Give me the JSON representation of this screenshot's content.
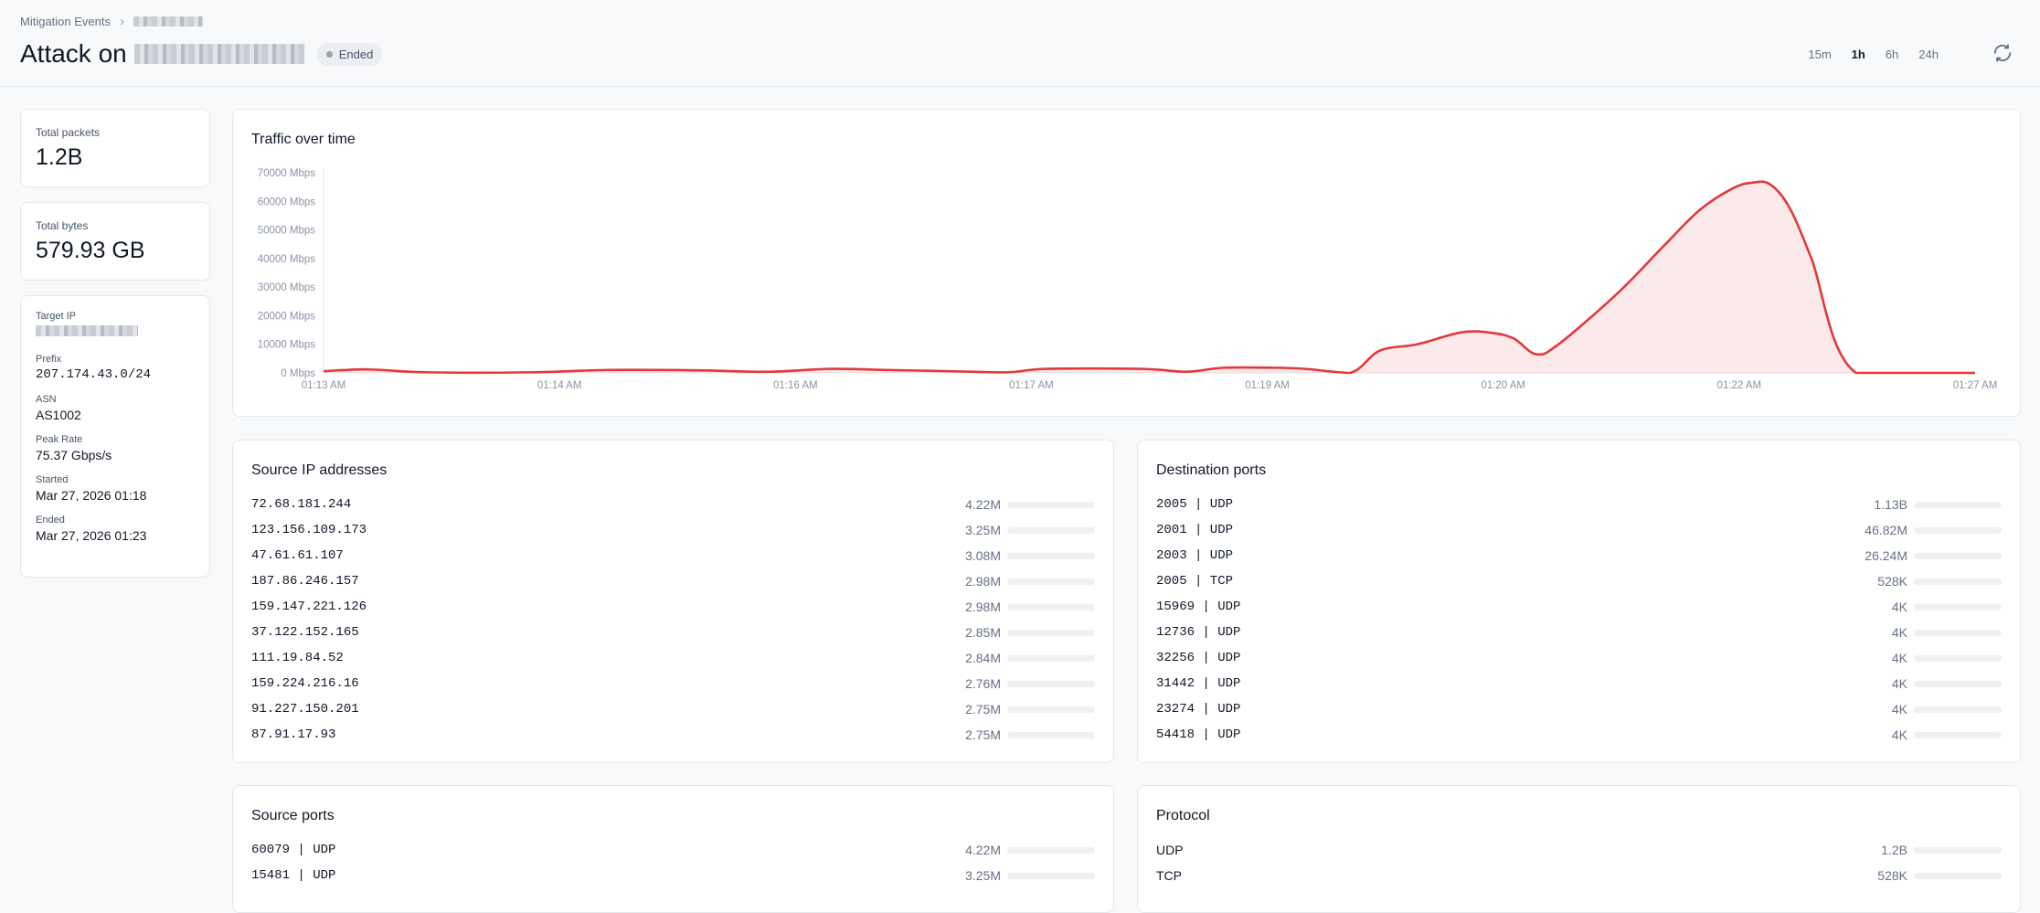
{
  "breadcrumb": {
    "root": "Mitigation Events"
  },
  "header": {
    "title": "Attack on",
    "status": "Ended"
  },
  "time_ranges": [
    {
      "label": "15m",
      "active": false
    },
    {
      "label": "1h",
      "active": true
    },
    {
      "label": "6h",
      "active": false
    },
    {
      "label": "24h",
      "active": false
    }
  ],
  "stats": {
    "total_packets": {
      "label": "Total packets",
      "value": "1.2B"
    },
    "total_bytes": {
      "label": "Total bytes",
      "value": "579.93 GB"
    }
  },
  "info": {
    "target_ip_label": "Target IP",
    "prefix_label": "Prefix",
    "prefix": "207.174.43.0/24",
    "asn_label": "ASN",
    "asn": "AS1002",
    "peak_label": "Peak Rate",
    "peak": "75.37 Gbps/s",
    "started_label": "Started",
    "started": "Mar 27, 2026 01:18",
    "ended_label": "Ended",
    "ended": "Mar 27, 2026 01:23"
  },
  "traffic": {
    "title": "Traffic over time"
  },
  "chart_data": {
    "type": "area",
    "title": "Traffic over time",
    "y_ticks": [
      "0 Mbps",
      "10000 Mbps",
      "20000 Mbps",
      "30000 Mbps",
      "40000 Mbps",
      "50000 Mbps",
      "60000 Mbps",
      "70000 Mbps"
    ],
    "ylim": [
      0,
      70000
    ],
    "x_ticks": [
      "01:13 AM",
      "01:14 AM",
      "01:16 AM",
      "01:17 AM",
      "01:19 AM",
      "01:20 AM",
      "01:22 AM",
      "01:27 AM"
    ],
    "series": [
      {
        "color": "#e5383b",
        "points": [
          [
            0,
            600
          ],
          [
            3,
            1200
          ],
          [
            7,
            200
          ],
          [
            14,
            200
          ],
          [
            19,
            1000
          ],
          [
            25,
            900
          ],
          [
            30,
            400
          ],
          [
            34,
            1400
          ],
          [
            38,
            1000
          ],
          [
            42,
            600
          ],
          [
            46,
            200
          ],
          [
            48.5,
            1400
          ],
          [
            55,
            1400
          ],
          [
            58,
            400
          ],
          [
            60.5,
            1800
          ],
          [
            64,
            1800
          ],
          [
            66,
            1400
          ],
          [
            69,
            0
          ],
          [
            71,
            7800
          ],
          [
            73.5,
            10000
          ],
          [
            76.5,
            14200
          ],
          [
            78.5,
            14000
          ],
          [
            80,
            12000
          ],
          [
            81.5,
            6500
          ],
          [
            83,
            10000
          ],
          [
            87,
            28000
          ],
          [
            90,
            44000
          ],
          [
            92.5,
            57000
          ],
          [
            94.7,
            64500
          ],
          [
            96,
            66500
          ],
          [
            97.2,
            66000
          ],
          [
            98.5,
            58000
          ],
          [
            100,
            40000
          ],
          [
            103,
            0
          ],
          [
            111,
            0
          ]
        ]
      }
    ]
  },
  "source_ips": {
    "title": "Source IP addresses",
    "rows": [
      {
        "label": "72.68.181.244",
        "value": "4.22M"
      },
      {
        "label": "123.156.109.173",
        "value": "3.25M"
      },
      {
        "label": "47.61.61.107",
        "value": "3.08M"
      },
      {
        "label": "187.86.246.157",
        "value": "2.98M"
      },
      {
        "label": "159.147.221.126",
        "value": "2.98M"
      },
      {
        "label": "37.122.152.165",
        "value": "2.85M"
      },
      {
        "label": "111.19.84.52",
        "value": "2.84M"
      },
      {
        "label": "159.224.216.16",
        "value": "2.76M"
      },
      {
        "label": "91.227.150.201",
        "value": "2.75M"
      },
      {
        "label": "87.91.17.93",
        "value": "2.75M"
      }
    ]
  },
  "dest_ports": {
    "title": "Destination ports",
    "rows": [
      {
        "label": "2005 | UDP",
        "value": "1.13B"
      },
      {
        "label": "2001 | UDP",
        "value": "46.82M"
      },
      {
        "label": "2003 | UDP",
        "value": "26.24M"
      },
      {
        "label": "2005 | TCP",
        "value": "528K"
      },
      {
        "label": "15969 | UDP",
        "value": "4K"
      },
      {
        "label": "12736 | UDP",
        "value": "4K"
      },
      {
        "label": "32256 | UDP",
        "value": "4K"
      },
      {
        "label": "31442 | UDP",
        "value": "4K"
      },
      {
        "label": "23274 | UDP",
        "value": "4K"
      },
      {
        "label": "54418 | UDP",
        "value": "4K"
      }
    ]
  },
  "source_ports": {
    "title": "Source ports",
    "rows": [
      {
        "label": "60079 | UDP",
        "value": "4.22M"
      },
      {
        "label": "15481 | UDP",
        "value": "3.25M"
      }
    ]
  },
  "protocol": {
    "title": "Protocol",
    "rows": [
      {
        "label": "UDP",
        "value": "1.2B"
      },
      {
        "label": "TCP",
        "value": "528K"
      }
    ]
  }
}
